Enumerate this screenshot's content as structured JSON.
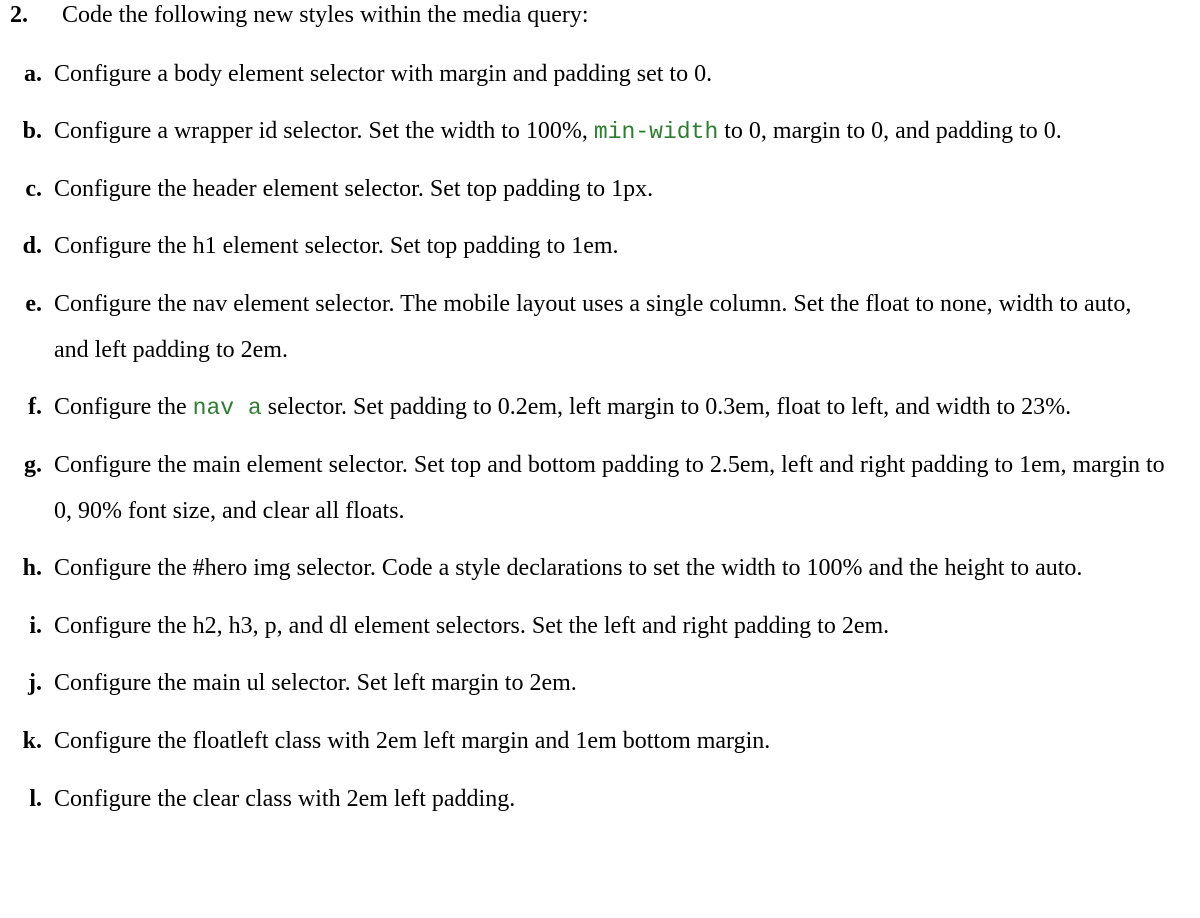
{
  "top": {
    "number": "2.",
    "text": "Code the following new styles within the media query:"
  },
  "items": [
    {
      "letter": "a.",
      "segments": [
        {
          "t": "text",
          "v": "Configure a body element selector with margin and padding set to 0."
        }
      ]
    },
    {
      "letter": "b.",
      "segments": [
        {
          "t": "text",
          "v": "Configure a wrapper id selector. Set the width to 100%, "
        },
        {
          "t": "code",
          "v": "min-width"
        },
        {
          "t": "text",
          "v": " to 0, margin to 0, and padding to 0."
        }
      ]
    },
    {
      "letter": "c.",
      "segments": [
        {
          "t": "text",
          "v": "Configure the header element selector. Set top padding to 1px."
        }
      ]
    },
    {
      "letter": "d.",
      "segments": [
        {
          "t": "text",
          "v": "Configure the h1 element selector. Set top padding to 1em."
        }
      ]
    },
    {
      "letter": "e.",
      "segments": [
        {
          "t": "text",
          "v": "Configure the nav element selector. The mobile layout uses a single column. Set the float to none, width to auto, and left padding to 2em."
        }
      ]
    },
    {
      "letter": "f.",
      "segments": [
        {
          "t": "text",
          "v": "Configure the "
        },
        {
          "t": "code",
          "v": "nav a"
        },
        {
          "t": "text",
          "v": " selector. Set padding to 0.2em, left margin to 0.3em, float to left, and width to 23%."
        }
      ]
    },
    {
      "letter": "g.",
      "segments": [
        {
          "t": "text",
          "v": "Configure the main element selector. Set top and bottom padding to 2.5em, left and right padding to 1em, margin to 0, 90% font size, and clear all floats."
        }
      ]
    },
    {
      "letter": "h.",
      "segments": [
        {
          "t": "text",
          "v": "Configure the #hero img selector. Code a style declarations to set the width to 100% and the height to auto."
        }
      ]
    },
    {
      "letter": "i.",
      "segments": [
        {
          "t": "text",
          "v": "Configure the h2, h3, p, and dl element selectors. Set the left and right padding to 2em."
        }
      ]
    },
    {
      "letter": "j.",
      "segments": [
        {
          "t": "text",
          "v": "Configure the main ul selector. Set left margin to 2em."
        }
      ]
    },
    {
      "letter": "k.",
      "segments": [
        {
          "t": "text",
          "v": "Configure the floatleft class with 2em left margin and 1em bottom margin."
        }
      ]
    },
    {
      "letter": "l.",
      "segments": [
        {
          "t": "text",
          "v": "Configure the clear class with 2em left padding."
        }
      ]
    }
  ]
}
